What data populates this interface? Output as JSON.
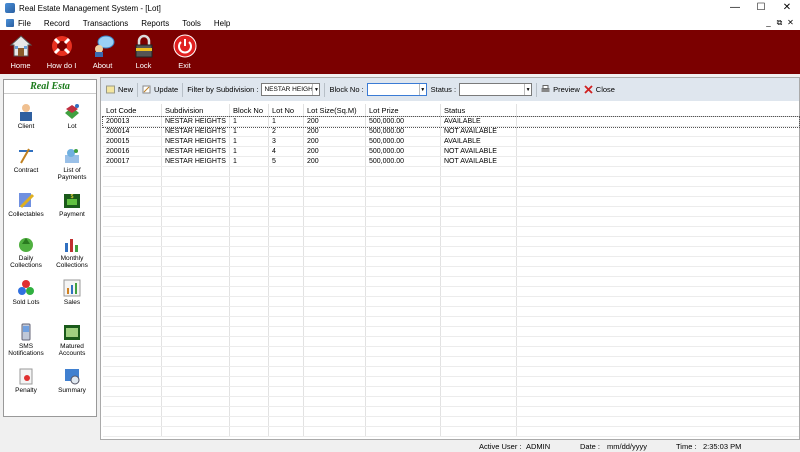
{
  "window": {
    "title": "Real Estate Management System - [Lot]",
    "min": "—",
    "max": "☐",
    "close": "✕"
  },
  "mdi": {
    "min": "_",
    "restore": "⧉",
    "close": "✕"
  },
  "menu": [
    "File",
    "Record",
    "Transactions",
    "Reports",
    "Tools",
    "Help"
  ],
  "toolbar": [
    {
      "label": "Home",
      "icon": "house-icon"
    },
    {
      "label": "How do I",
      "icon": "lifebuoy-icon"
    },
    {
      "label": "About",
      "icon": "speech-bubble-icon"
    },
    {
      "label": "Lock",
      "icon": "padlock-icon"
    },
    {
      "label": "Exit",
      "icon": "power-icon"
    }
  ],
  "sidebar": {
    "header": "Real Esta",
    "items": [
      {
        "label": "Client",
        "icon": "client-icon"
      },
      {
        "label": "Lot",
        "icon": "lot-icon"
      },
      {
        "label": "Contract",
        "icon": "contract-icon"
      },
      {
        "label": "List of Payments",
        "icon": "payments-list-icon"
      },
      {
        "label": "Collectables",
        "icon": "collectables-icon"
      },
      {
        "label": "Payment",
        "icon": "payment-icon"
      },
      {
        "label": "Daily Collections",
        "icon": "daily-collections-icon"
      },
      {
        "label": "Monthly Collections",
        "icon": "monthly-collections-icon"
      },
      {
        "label": "Sold Lots",
        "icon": "sold-lots-icon"
      },
      {
        "label": "Sales",
        "icon": "sales-icon"
      },
      {
        "label": "SMS Notifications",
        "icon": "sms-icon"
      },
      {
        "label": "Matured Accounts",
        "icon": "matured-accounts-icon"
      },
      {
        "label": "Penalty",
        "icon": "penalty-icon"
      },
      {
        "label": "Summary",
        "icon": "summary-icon"
      }
    ]
  },
  "controls": {
    "new_label": "New",
    "update_label": "Update",
    "filter_label": "Filter by Subdivision :",
    "filter_value": "NESTAR HEIGH",
    "block_label": "Block No :",
    "block_value": "",
    "status_label": "Status :",
    "status_value": "",
    "preview_label": "Preview",
    "close_label": "Close"
  },
  "table": {
    "columns": [
      "Lot Code",
      "Subdivision",
      "Block No",
      "Lot No",
      "Lot Size(Sq.M)",
      "Lot Prize",
      "Status"
    ],
    "rows": [
      [
        "200013",
        "NESTAR HEIGHTS",
        "1",
        "1",
        "200",
        "500,000.00",
        "AVAILABLE"
      ],
      [
        "200014",
        "NESTAR HEIGHTS",
        "1",
        "2",
        "200",
        "500,000.00",
        "NOT AVAILABLE"
      ],
      [
        "200015",
        "NESTAR HEIGHTS",
        "1",
        "3",
        "200",
        "500,000.00",
        "AVAILABLE"
      ],
      [
        "200016",
        "NESTAR HEIGHTS",
        "1",
        "4",
        "200",
        "500,000.00",
        "NOT AVAILABLE"
      ],
      [
        "200017",
        "NESTAR HEIGHTS",
        "1",
        "5",
        "200",
        "500,000.00",
        "NOT AVAILABLE"
      ]
    ]
  },
  "status": {
    "user_label": "Active User :",
    "user_value": "ADMIN",
    "date_label": "Date :",
    "date_value": "mm/dd/yyyy",
    "time_label": "Time :",
    "time_value": "2:35:03 PM"
  }
}
